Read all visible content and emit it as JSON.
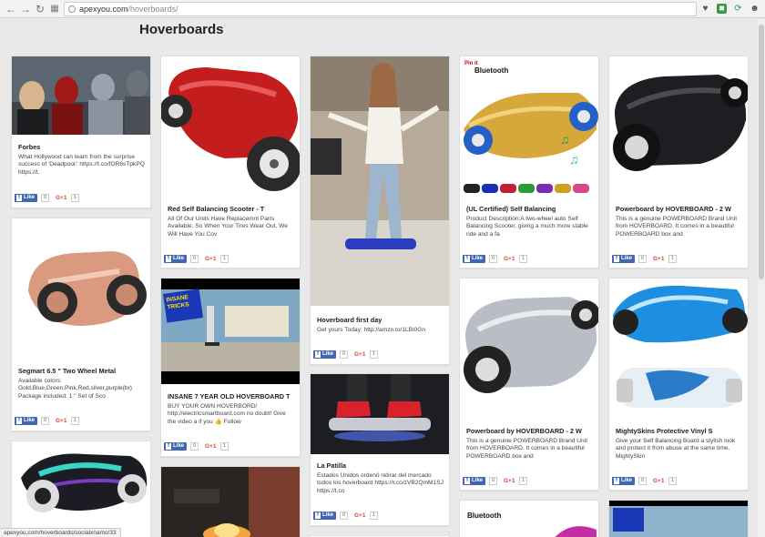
{
  "browser": {
    "url_domain": "apexyou.com",
    "url_path": "/hoverboards/",
    "status_url": "apexyou.com/hoverboards/socialxnamo/33"
  },
  "page": {
    "title": "Hoverboards"
  },
  "share": {
    "fb_label": "Like",
    "fb_count": "0",
    "gplus_label": "G+1",
    "gplus_count": "1"
  },
  "cards": [
    {
      "title": "Forbes",
      "desc": "What Hollywood can learn from the surprise success of 'Deadpool:' https://t.co/fOR6sTpkPQ https://t."
    },
    {
      "title": "Segmart 6.5 \" Two Wheel Metal",
      "desc": "Available colors: Gold,Blue,Green,Pink,Red,silver,purple(br) Package included: 1 \" Set of Sco"
    },
    {
      "title": "Red Self Balancing Scooter - T",
      "desc": "All Of Our Units Have Replacemnt Parts Available. So When Your Tires Wear Out, We Will Have You Cov"
    },
    {
      "title": "INSANE 7 YEAR OLD HOVERBOARD T",
      "desc": "BUY YOUR OWN HOVERBORD/ http://electricsmartboard.com no doubt! Give the video a if you 👍 Follow"
    },
    {
      "title": "Hoverboard first day",
      "desc": "Get yours Today: http://amzn.to/1LBi0Gn"
    },
    {
      "title": "La Patilla",
      "desc": "Estados Unidos ordenó retirar del mercado todos los hoverboard https://t.co/zVB2QmM1SJ https://t.co"
    },
    {
      "title": "(UL Certified) Self Balancing",
      "desc": "Product Description:A two-wheel auto Self Balancing Scooter, giving a much more stable ride and a fa"
    },
    {
      "title": "Powerboard by HOVERBOARD - 2 W",
      "desc": "This is a genuine POWERBOARD Brand Unit from HOVERBOARD. It comes in a beautiful POWERBOARD box and"
    },
    {
      "title": "Powerboard by HOVERBOARD - 2 W",
      "desc": "This is a genuine POWERBOARD Brand Unit from HOVERBOARD. It comes in a beautiful POWERBOARD box and"
    },
    {
      "title": "MightySkins Protective Vinyl S",
      "desc": "Give your Self Balancing Board a stylish look and protect it from abuse at the same time. MightySkin"
    }
  ],
  "image_text": {
    "pinit": "Pin it",
    "bluetooth": "Bluetooth",
    "insane_badge": "INSANE TRICKS"
  },
  "colors": {
    "fb": "#4267b2",
    "gplus": "#d14836",
    "page_bg": "#e9e9e9"
  }
}
